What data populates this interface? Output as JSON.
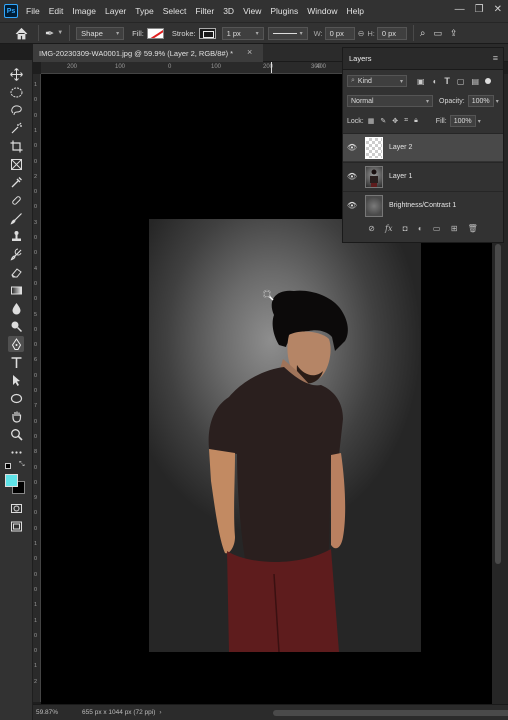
{
  "app": {
    "logo": "Ps"
  },
  "menu": [
    "File",
    "Edit",
    "Image",
    "Layer",
    "Type",
    "Select",
    "Filter",
    "3D",
    "View",
    "Plugins",
    "Window",
    "Help"
  ],
  "options": {
    "mode": "Shape",
    "fill_label": "Fill:",
    "stroke_label": "Stroke:",
    "stroke_width": "1 px",
    "w_label": "W:",
    "w_value": "0 px",
    "h_label": "H:",
    "h_value": "0 px"
  },
  "document": {
    "tab_title": "IMG-20230309-WA0001.jpg @ 59.9% (Layer 2, RGB/8#) *",
    "close_glyph": "×"
  },
  "ruler": {
    "h_ticks": [
      "200",
      "100",
      "0",
      "100",
      "200",
      "300",
      "400"
    ],
    "v_ticks": [
      "1",
      "0",
      "0",
      "1",
      "0",
      "0",
      "2",
      "0",
      "0",
      "3",
      "0",
      "0",
      "4",
      "0",
      "0",
      "5",
      "0",
      "0",
      "6",
      "0",
      "0",
      "7",
      "0",
      "0",
      "8",
      "0",
      "0",
      "9",
      "0",
      "0",
      "1",
      "0",
      "0",
      "0",
      "1",
      "1",
      "0",
      "0",
      "1",
      "2"
    ]
  },
  "layers_panel": {
    "title": "Layers",
    "kind_label": "Kind",
    "blend_mode": "Normal",
    "opacity_label": "Opacity:",
    "opacity_value": "100%",
    "lock_label": "Lock:",
    "fill_label": "Fill:",
    "fill_value": "100%",
    "layers": [
      {
        "name": "Layer 2",
        "thumb": "transparent",
        "selected": true
      },
      {
        "name": "Layer 1",
        "thumb": "photo",
        "selected": false
      },
      {
        "name": "Brightness/Contrast 1",
        "thumb": "adjustment",
        "selected": false
      }
    ]
  },
  "status": {
    "zoom": "59.87%",
    "doc_info": "655 px x 1044 px (72 ppi)"
  },
  "colors": {
    "foreground": "#5fe3e8",
    "background": "#000000",
    "accent": "#31a8ff"
  },
  "tools": [
    "move-icon",
    "marquee-icon",
    "lasso-icon",
    "quick-select-icon",
    "crop-icon",
    "frame-icon",
    "eyedropper-icon",
    "healing-icon",
    "brush-icon",
    "clone-stamp-icon",
    "history-brush-icon",
    "eraser-icon",
    "gradient-icon",
    "blur-icon",
    "dodge-icon",
    "pen-icon",
    "type-icon",
    "path-select-icon",
    "ellipse-icon",
    "hand-icon",
    "zoom-icon",
    "more-icon"
  ]
}
